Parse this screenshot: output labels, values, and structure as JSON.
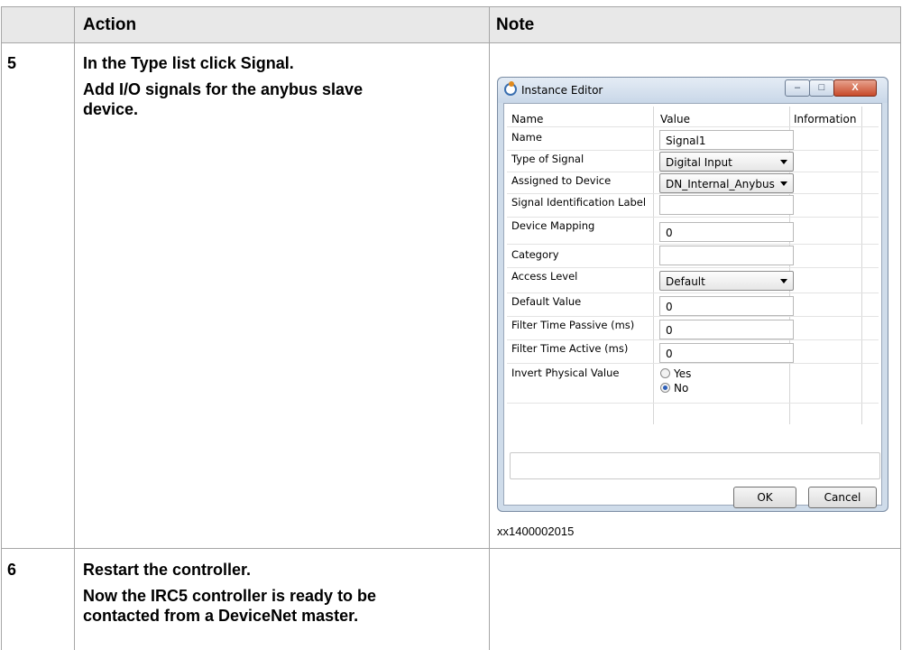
{
  "headers": {
    "action": "Action",
    "note": "Note"
  },
  "rows": [
    {
      "step": "5",
      "action_parts": [
        "In the ",
        "Type",
        " list click ",
        "Signal",
        "."
      ],
      "action_line2": "Add I/O signals for the anybus slave",
      "action_line3": "device."
    },
    {
      "step": "6",
      "action_line1": "Restart the controller.",
      "action_line2": "Now the IRC5 controller is ready to be",
      "action_line3": "contacted from a DeviceNet master."
    }
  ],
  "dialog": {
    "title": "Instance Editor",
    "window_buttons": {
      "minimize": "–",
      "maximize": "□",
      "close": "X"
    },
    "columns": [
      "Name",
      "Value",
      "Information"
    ],
    "fields": [
      {
        "name": "Name",
        "value": "Signal1",
        "kind": "text"
      },
      {
        "name": "Type of Signal",
        "value": "Digital Input",
        "kind": "select"
      },
      {
        "name": "Assigned to Device",
        "value": "DN_Internal_Anybus",
        "kind": "select"
      },
      {
        "name": "Signal Identification Label",
        "value": "",
        "kind": "text"
      },
      {
        "name": "Device Mapping",
        "value": "0",
        "kind": "text"
      },
      {
        "name": "Category",
        "value": "",
        "kind": "text"
      },
      {
        "name": "Access Level",
        "value": "Default",
        "kind": "select"
      },
      {
        "name": "Default Value",
        "value": "0",
        "kind": "text"
      },
      {
        "name": "Filter Time Passive (ms)",
        "value": "0",
        "kind": "text"
      },
      {
        "name": "Filter Time Active (ms)",
        "value": "0",
        "kind": "text"
      }
    ],
    "invert": {
      "name": "Invert Physical Value",
      "options": [
        "Yes",
        "No"
      ],
      "selected": "No"
    },
    "ok_label": "OK",
    "cancel_label": "Cancel"
  },
  "caption": "xx1400002015"
}
